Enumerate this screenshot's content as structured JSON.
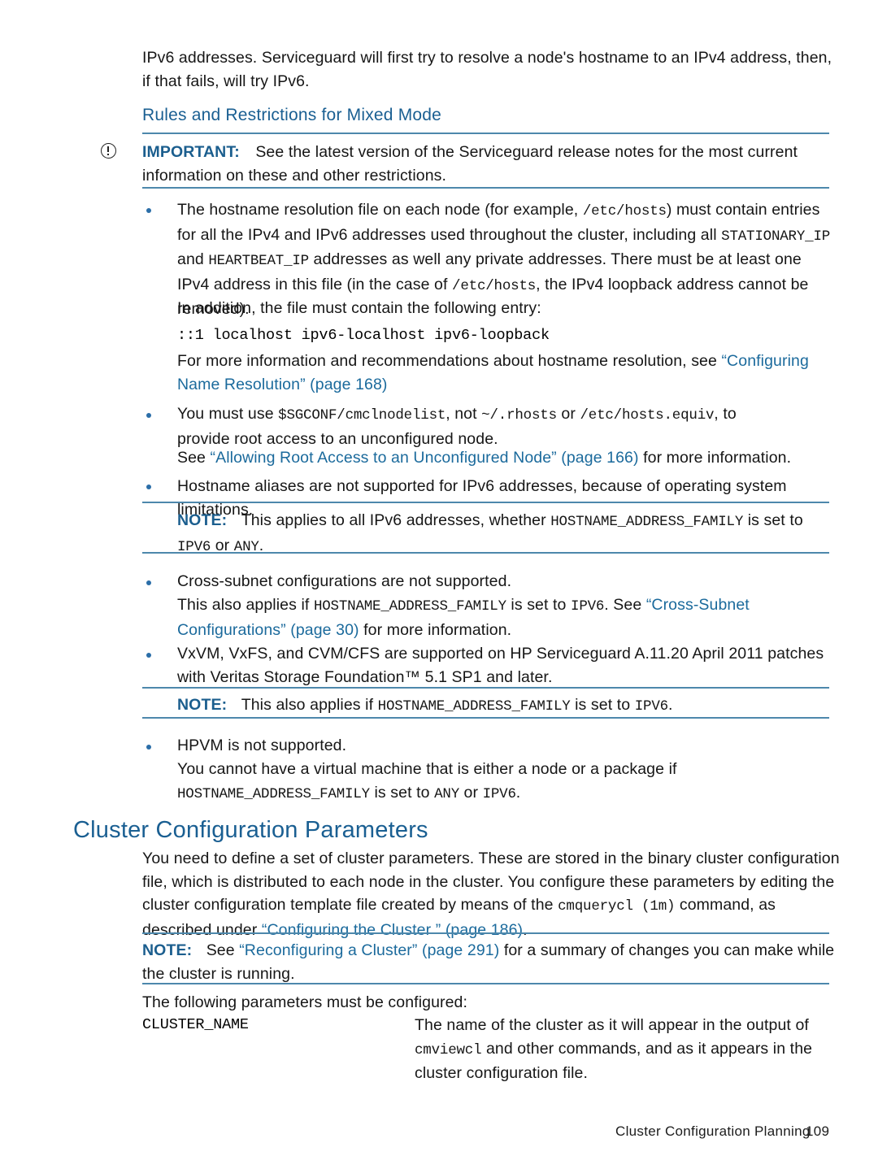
{
  "document": {
    "page_number": "109",
    "footer_title": "Cluster Configuration Planning",
    "accent_heading_color": "#1a5f92",
    "link_color": "#1b6a9c",
    "rule_color": "#4d88ac"
  },
  "intro": {
    "line1": "IPv6 addresses. Serviceguard will first try to resolve a node's hostname to an IPv4 address, then,",
    "line2": "if that fails, will try IPv6."
  },
  "section_heading": "Rules and Restrictions for Mixed Mode",
  "important_note": {
    "icon": "important-circle-exclamation-icon",
    "label": "IMPORTANT:",
    "line1": "See the latest version of the Serviceguard release notes for the most current",
    "line2": "information on these and other restrictions."
  },
  "bullets": [
    {
      "id": "hostname-resolution-file",
      "segments": [
        {
          "t": "The hostname resolution file on each node (for example, ",
          "s": "text"
        },
        {
          "t": "/etc/hosts",
          "s": "mono"
        },
        {
          "t": ") must contain entries",
          "s": "text"
        }
      ],
      "line2": [
        {
          "t": "for all the IPv4 and IPv6 addresses used throughout the cluster, including all ",
          "s": "text"
        },
        {
          "t": "STATIONARY_IP",
          "s": "mono"
        }
      ],
      "line3": [
        {
          "t": "and ",
          "s": "text"
        },
        {
          "t": "HEARTBEAT_IP",
          "s": "mono"
        },
        {
          "t": " addresses as well any private addresses. There must be at least one",
          "s": "text"
        }
      ],
      "line4": [
        {
          "t": "IPv4 address in this file (in the case of ",
          "s": "text"
        },
        {
          "t": "/etc/hosts",
          "s": "mono"
        },
        {
          "t": ", the IPv4 loopback address cannot be",
          "s": "text"
        }
      ],
      "line5": [
        {
          "t": "removed).",
          "s": "text"
        }
      ],
      "sub_paragraph": "In addition, the file must contain the following entry:",
      "code_line": "::1 localhost ipv6-localhost ipv6-loopback",
      "xref_line1_pre": "For more information and recommendations about hostname resolution, see ",
      "xref_link1": "“Configuring",
      "xref_link2": "Name Resolution” (page",
      "xref_tail": " 168).",
      "xref_link_page": "168)"
    },
    {
      "id": "cmclnodelist",
      "line1": [
        {
          "t": "You must use ",
          "s": "text"
        },
        {
          "t": "$SGCONF/cmclnodelist",
          "s": "mono"
        },
        {
          "t": ", not ",
          "s": "text"
        },
        {
          "t": "~/.rhosts",
          "s": "mono"
        },
        {
          "t": " or ",
          "s": "text"
        },
        {
          "t": "/etc/hosts.equiv",
          "s": "mono"
        },
        {
          "t": ", to",
          "s": "text"
        }
      ],
      "line2": "provide root access to an unconfigured node.",
      "xref_pre": "See ",
      "xref_link": "“Allowing Root Access to an Unconfigured Node” (page 166)",
      "xref_post": " for more information."
    },
    {
      "id": "hostname-aliases",
      "line1": "Hostname aliases are not supported for IPv6 addresses, because of operating system limitations."
    },
    {
      "id": "cross-subnet",
      "line1": "Cross-subnet configurations are not supported."
    },
    {
      "id": "vxvm-vxfs-cvm-cfs",
      "line1": "VxVM, VxFS, and CVM/CFS are supported on HP Serviceguard A.11.20 April 2011 patches",
      "line2": "with Veritas Storage Foundation™ 5.1 SP1 and later."
    },
    {
      "id": "hpvm",
      "line1": "HPVM is not supported.",
      "line2": "You cannot have a virtual machine that is either a node or a package if",
      "line3_mono": "HOSTNAME_ADDRESS_FAMILY",
      "line3_mid": " is set to ",
      "line3_any": "ANY",
      "line3_or": " or ",
      "line3_ipv6": "IPV6",
      "line3_end": "."
    }
  ],
  "note_ipv6_addresses": {
    "label": "NOTE:",
    "line1_pre": "This applies to all IPv6 addresses, whether ",
    "line1_mono": "HOSTNAME_ADDRESS_FAMILY",
    "line1_post": " is set to",
    "line2_mono1": "IPV6",
    "line2_mid": " or ",
    "line2_mono2": "ANY",
    "line2_end": "."
  },
  "cross_subnet_detail": {
    "line1_pre": "This also applies if ",
    "line1_mono1": "HOSTNAME_ADDRESS_FAMILY",
    "line1_mid": " is set to ",
    "line1_mono2": "IPV6",
    "line1_post": ". See ",
    "line1_link": "“Cross-Subnet",
    "line2_link": "Configurations” (page 30)",
    "line2_post": " for more information."
  },
  "note_also_applies": {
    "label": "NOTE:",
    "pre": "This also applies if ",
    "mono1": "HOSTNAME_ADDRESS_FAMILY",
    "mid": " is set to ",
    "mono2": "IPV6",
    "end": "."
  },
  "cluster_section": {
    "heading": "Cluster Configuration Parameters",
    "body_line1": "You need to define a set of cluster parameters. These are stored in the binary cluster configuration",
    "body_line2": "file, which is distributed to each node in the cluster. You configure these parameters by editing the",
    "body_line3_pre": "cluster configuration template file created by means of the ",
    "body_line3_mono": "cmquerycl (1m)",
    "body_line3_post": " command, as",
    "body_line4_pre": "described under ",
    "body_line4_link": "“Configuring the Cluster ” (page 186)",
    "body_line4_post": ".",
    "note": {
      "label": "NOTE:",
      "pre": "See ",
      "link": "“Reconfiguring a Cluster” (page 291)",
      "post": " for a summary of changes you can make while",
      "line2": "the cluster is running."
    },
    "following_params": "The following parameters must be configured:",
    "params": [
      {
        "name": "CLUSTER_NAME",
        "desc_line1": "The name of the cluster as it will appear in the output of",
        "desc_line2_mono": "cmviewcl",
        "desc_line2_post": " and other commands, and as it appears in the",
        "desc_line3": "cluster configuration file."
      }
    ]
  }
}
